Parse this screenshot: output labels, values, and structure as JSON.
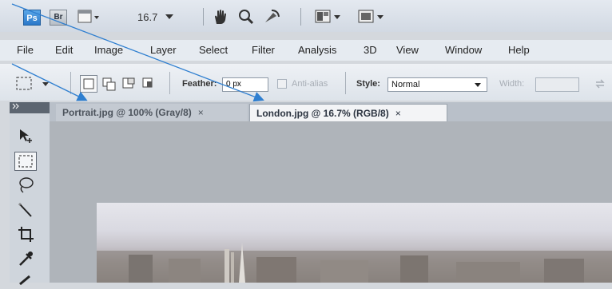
{
  "app_bar": {
    "ps_label": "Ps",
    "br_label": "Br",
    "zoom_value": "16.7"
  },
  "menu": {
    "items": [
      "File",
      "Edit",
      "Image",
      "Layer",
      "Select",
      "Filter",
      "Analysis",
      "3D",
      "View",
      "Window",
      "Help"
    ]
  },
  "options": {
    "feather_label": "Feather:",
    "feather_value": "0 px",
    "antialias_label": "Anti-alias",
    "style_label": "Style:",
    "style_value": "Normal",
    "width_label": "Width:"
  },
  "tabs": [
    {
      "label": "Portrait.jpg @ 100% (Gray/8)",
      "close": "×"
    },
    {
      "label": "London.jpg @ 16.7% (RGB/8)",
      "close": "×"
    }
  ],
  "colors": {
    "arrow": "#2f7fd0",
    "active_tab": "#f3f4f6"
  }
}
